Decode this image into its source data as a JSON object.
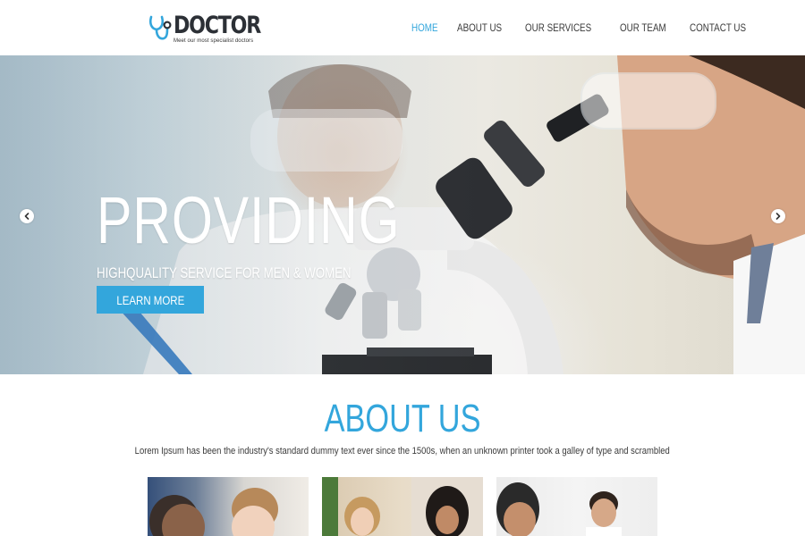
{
  "brand": {
    "name": "DOCTOR",
    "tagline": "Meet our most specialist doctors",
    "accent_color": "#33a6dc"
  },
  "nav": {
    "items": [
      {
        "label": "HOME",
        "active": true
      },
      {
        "label": "ABOUT US",
        "active": false
      },
      {
        "label": "OUR SERVICES",
        "active": false
      },
      {
        "label": "OUR TEAM",
        "active": false
      },
      {
        "label": "CONTACT US",
        "active": false
      }
    ]
  },
  "hero": {
    "heading": "PROVIDING",
    "subheading": "HIGHQUALITY SERVICE FOR MEN & WOMEN",
    "button_label": "LEARN MORE",
    "prev_icon": "chevron-left-icon",
    "next_icon": "chevron-right-icon"
  },
  "about": {
    "title": "ABOUT US",
    "text": "Lorem Ipsum has been the industry's standard dummy text ever since the 1500s, when an unknown printer took a galley of type and scrambled"
  }
}
